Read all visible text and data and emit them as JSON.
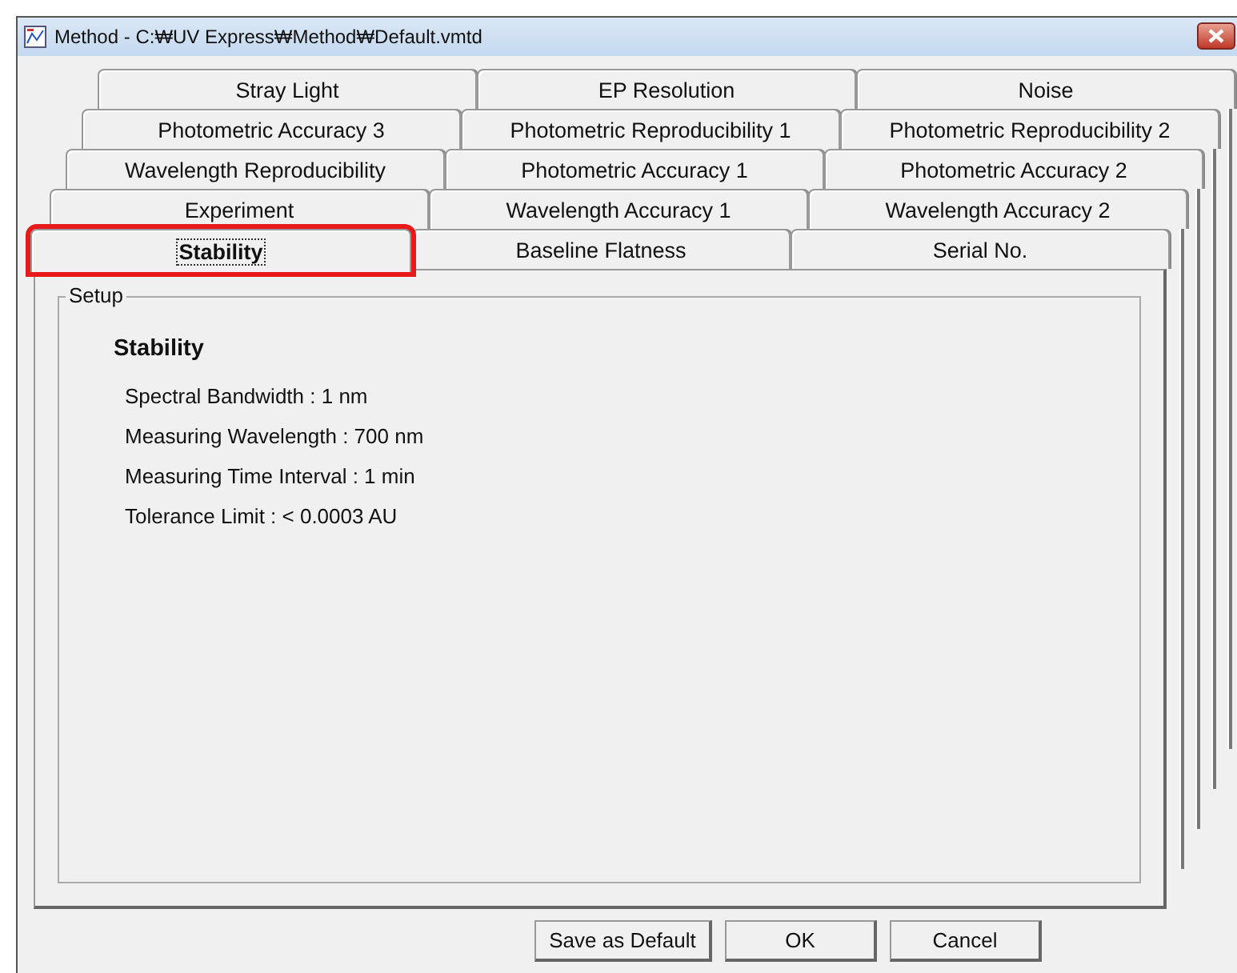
{
  "window": {
    "title": "Method - C:₩UV Express₩Method₩Default.vmtd"
  },
  "tab_rows": [
    {
      "tabs": [
        {
          "label": "Stray Light",
          "selected": false
        },
        {
          "label": "EP Resolution",
          "selected": false
        },
        {
          "label": "Noise",
          "selected": false
        }
      ]
    },
    {
      "tabs": [
        {
          "label": "Photometric Accuracy 3",
          "selected": false
        },
        {
          "label": "Photometric Reproducibility 1",
          "selected": false
        },
        {
          "label": "Photometric Reproducibility 2",
          "selected": false
        }
      ]
    },
    {
      "tabs": [
        {
          "label": "Wavelength Reproducibility",
          "selected": false
        },
        {
          "label": "Photometric Accuracy 1",
          "selected": false
        },
        {
          "label": "Photometric Accuracy 2",
          "selected": false
        }
      ]
    },
    {
      "tabs": [
        {
          "label": "Experiment",
          "selected": false
        },
        {
          "label": "Wavelength Accuracy 1",
          "selected": false
        },
        {
          "label": "Wavelength Accuracy 2",
          "selected": false
        }
      ]
    },
    {
      "tabs": [
        {
          "label": "Stability",
          "selected": true,
          "highlighted": true
        },
        {
          "label": "Baseline Flatness",
          "selected": false,
          "highlighted": false
        },
        {
          "label": "Serial No.",
          "selected": false,
          "highlighted": false
        }
      ]
    }
  ],
  "setup": {
    "legend": "Setup",
    "heading": "Stability",
    "lines": [
      "Spectral Bandwidth : 1 nm",
      "Measuring Wavelength : 700 nm",
      "Measuring Time Interval : 1 min",
      "Tolerance Limit : < 0.0003 AU"
    ]
  },
  "buttons": [
    "Save as Default",
    "OK",
    "Cancel"
  ]
}
